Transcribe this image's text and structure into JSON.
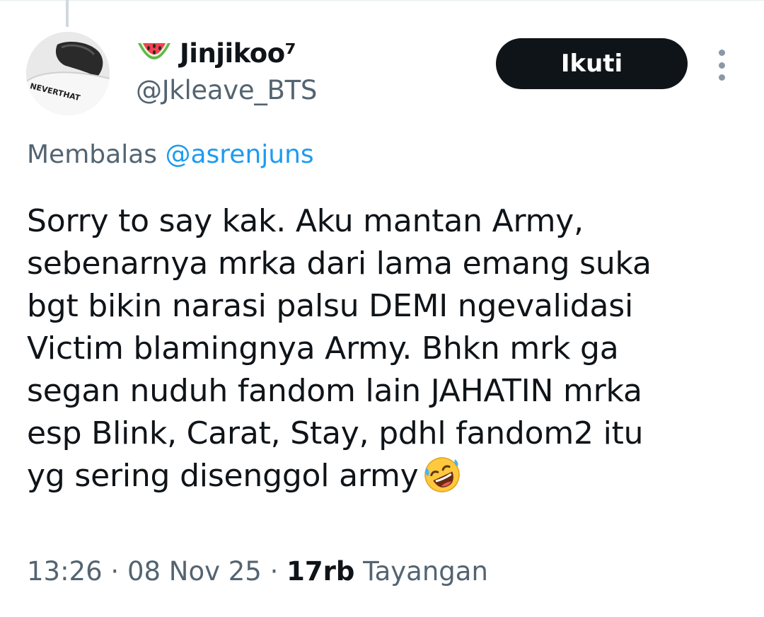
{
  "user": {
    "display_name": "Jinjikoo⁷",
    "handle": "@Jkleave_BTS",
    "name_emoji_icon": "watermelon-icon",
    "avatar_shirt_text": "NEVERTHAT"
  },
  "actions": {
    "follow_label": "Ikuti",
    "more_icon": "more-vertical-icon"
  },
  "reply": {
    "prefix": "Membalas",
    "mention": "@asrenjuns"
  },
  "tweet": {
    "lines": [
      "Sorry to say kak. Aku mantan Army,",
      "sebenarnya mrka dari lama emang suka",
      "bgt bikin narasi palsu DEMI ngevalidasi",
      "Victim blamingnya Army. Bhkn mrk ga",
      "segan nuduh fandom lain JAHATIN mrka",
      "esp Blink, Carat, Stay, pdhl fandom2 itu",
      "yg sering disenggol army"
    ],
    "trailing_emoji_icon": "rolling-on-floor-laughing-icon"
  },
  "meta": {
    "time": "13:26",
    "separator": " · ",
    "date": "08 Nov 25",
    "views_count": "17rb",
    "views_label": "Tayangan"
  },
  "colors": {
    "text": "#0f1419",
    "secondary": "#536471",
    "link": "#1d9bf0",
    "button_bg": "#0f1419",
    "button_text": "#ffffff"
  }
}
